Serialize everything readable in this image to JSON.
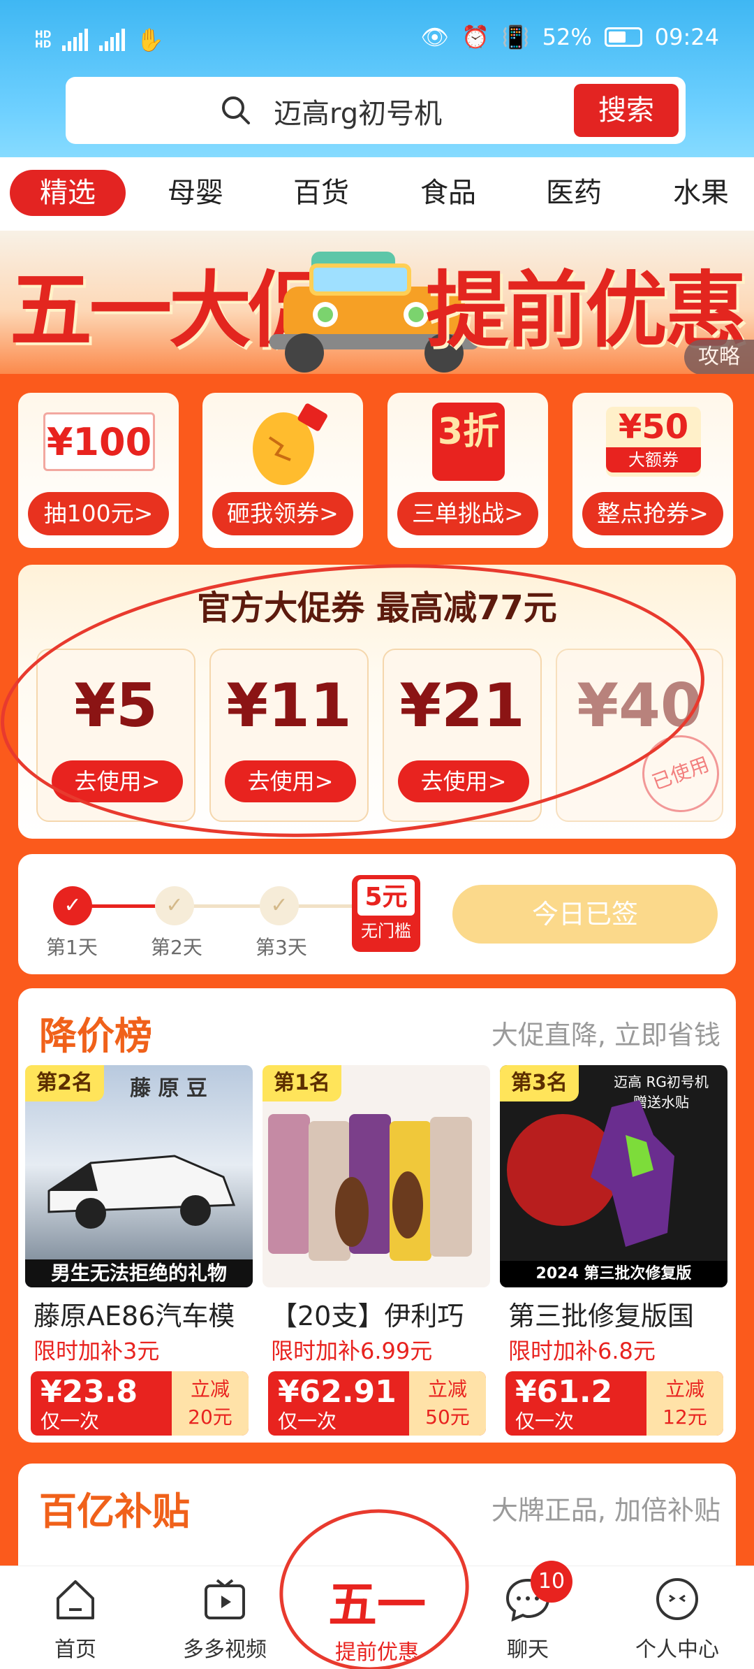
{
  "status": {
    "time": "09:24",
    "battery": "52%",
    "net1": "4G",
    "net2": "4G",
    "hd": "HD"
  },
  "search": {
    "query": "迈高rg初号机",
    "button": "搜索"
  },
  "categories": [
    "精选",
    "母婴",
    "百货",
    "食品",
    "医药",
    "水果"
  ],
  "banner": {
    "left": "五一大促",
    "right": "提前优惠",
    "guide": "攻略"
  },
  "features": [
    {
      "badge": "¥100",
      "label": "抽100元>"
    },
    {
      "badge": "",
      "label": "砸我领券>"
    },
    {
      "badge": "3折",
      "label": "三单挑战>"
    },
    {
      "badge": "¥50",
      "badge2": "大额券",
      "label": "整点抢券>"
    }
  ],
  "coupons": {
    "title": "官方大促券 最高减77元",
    "items": [
      {
        "amount": "¥5",
        "action": "去使用>"
      },
      {
        "amount": "¥11",
        "action": "去使用>"
      },
      {
        "amount": "¥21",
        "action": "去使用>"
      },
      {
        "amount": "¥40",
        "stamp": "已使用"
      }
    ]
  },
  "signin": {
    "days": [
      "第1天",
      "第2天",
      "第3天"
    ],
    "reward_amount": "5元",
    "reward_desc": "无门槛",
    "button": "今日已签"
  },
  "price_drop": {
    "title": "降价榜",
    "subtitle": "大促直降, 立即省钱",
    "products": [
      {
        "rank": "第2名",
        "name": "藤原AE86汽车模",
        "subsidy": "限时加补3元",
        "price": "¥23.8",
        "once": "仅一次",
        "cut_label": "立减",
        "cut": "20元",
        "img_caption": "男生无法拒绝的礼物",
        "img_sign": "藤 原 豆"
      },
      {
        "rank": "第1名",
        "name": "【20支】伊利巧",
        "subsidy": "限时加补6.99元",
        "price": "¥62.91",
        "once": "仅一次",
        "cut_label": "立减",
        "cut": "50元"
      },
      {
        "rank": "第3名",
        "name": "第三批修复版国",
        "subsidy": "限时加补6.8元",
        "price": "¥61.2",
        "once": "仅一次",
        "cut_label": "立减",
        "cut": "12元",
        "img_caption": "2024 第三批次修复版",
        "img_top": "迈高 RG初号机 赠送水贴"
      }
    ]
  },
  "subsidy": {
    "title": "百亿补贴",
    "subtitle": "大牌正品, 加倍补贴"
  },
  "tabs": [
    {
      "label": "首页"
    },
    {
      "label": "多多视频"
    },
    {
      "label": "提前优惠",
      "big": "五一"
    },
    {
      "label": "聊天",
      "badge": "10"
    },
    {
      "label": "个人中心"
    }
  ],
  "colors": {
    "brand_red": "#e8231f",
    "orange_bg": "#fb5a1c",
    "sky": "#3fb7f3"
  }
}
